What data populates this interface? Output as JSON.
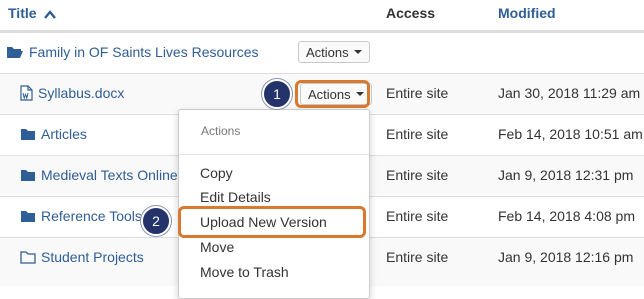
{
  "table": {
    "headers": {
      "title": "Title",
      "access": "Access",
      "modified": "Modified"
    },
    "parent_folder": {
      "name": "Family in OF Saints Lives Resources",
      "actions_label": "Actions"
    },
    "rows": [
      {
        "name": "Syllabus.docx",
        "type": "word-file",
        "access": "Entire site",
        "modified": "Jan 30, 2018 11:29 am",
        "actions_label": "Actions"
      },
      {
        "name": "Articles",
        "type": "folder",
        "access": "Entire site",
        "modified": "Feb 14, 2018 10:51 am"
      },
      {
        "name": "Medieval Texts Online",
        "type": "folder",
        "access": "Entire site",
        "modified": "Jan 9, 2018 12:31 pm"
      },
      {
        "name": "Reference Tools",
        "type": "folder",
        "access": "Entire site",
        "modified": "Feb 14, 2018 4:08 pm"
      },
      {
        "name": "Student Projects",
        "type": "folder-empty",
        "access": "Entire site",
        "modified": "Jan 9, 2018 12:16 pm"
      }
    ]
  },
  "dropdown": {
    "header": "Actions",
    "items": [
      "Copy",
      "Edit Details",
      "Upload New Version",
      "Move",
      "Move to Trash"
    ]
  },
  "callouts": {
    "step1": "1",
    "step2": "2"
  },
  "colors": {
    "link": "#2f5d95",
    "highlight": "#d9782f",
    "badge": "#24346b",
    "folder": "#2f5d95"
  }
}
